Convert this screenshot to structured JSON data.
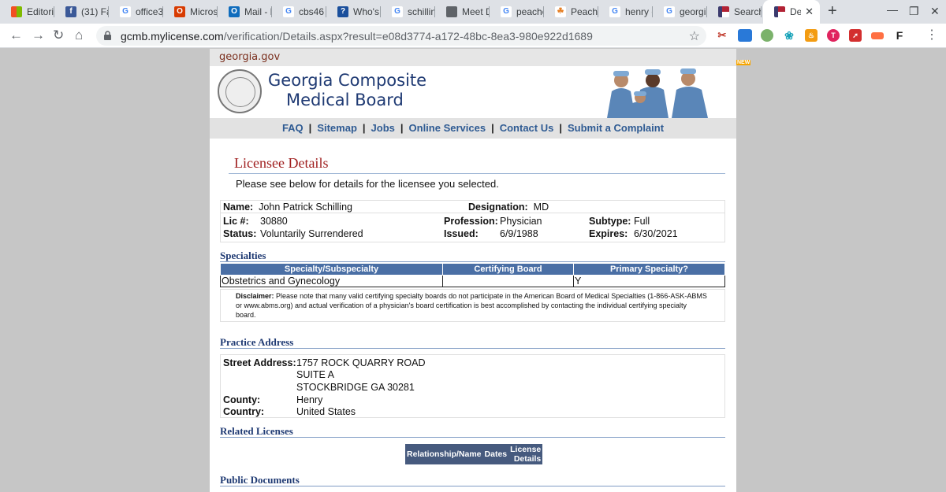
{
  "browser": {
    "tabs": [
      {
        "label": "Editoria",
        "fav": "windows"
      },
      {
        "label": "(31) Fa",
        "fav": "facebook"
      },
      {
        "label": "office3",
        "fav": "google"
      },
      {
        "label": "Micros",
        "fav": "office"
      },
      {
        "label": "Mail - R",
        "fav": "outlook"
      },
      {
        "label": "cbs46",
        "fav": "google"
      },
      {
        "label": "Who's",
        "fav": "generic"
      },
      {
        "label": "schillin",
        "fav": "google"
      },
      {
        "label": "Meet D",
        "fav": "globe"
      },
      {
        "label": "peachc",
        "fav": "google"
      },
      {
        "label": "Peachc",
        "fav": "peach"
      },
      {
        "label": "henry c",
        "fav": "google"
      },
      {
        "label": "georgia",
        "fav": "google"
      },
      {
        "label": "Search",
        "fav": "flag"
      },
      {
        "label": "Det",
        "fav": "flag",
        "active": true
      }
    ],
    "new_tab": "+",
    "close_tab": "✕",
    "url_host": "gcmb.mylicense.com",
    "url_path": "/verification/Details.aspx?result=e08d3774-a172-48bc-8ea3-980e922d1689",
    "ext_badge": "NEW"
  },
  "site": {
    "gagov": "georgia.gov",
    "board_line1": "Georgia Composite",
    "board_line2": "Medical Board",
    "menu": [
      "FAQ",
      "Sitemap",
      "Jobs",
      "Online Services",
      "Contact Us",
      "Submit a Complaint"
    ],
    "menu_sep": "|"
  },
  "details": {
    "title": "Licensee Details",
    "intro": "Please see below for details for the licensee you selected.",
    "name_label": "Name:",
    "name": "John Patrick Schilling",
    "designation_label": "Designation:",
    "designation": "MD",
    "lic_label": "Lic #:",
    "lic": "30880",
    "profession_label": "Profession:",
    "profession": "Physician",
    "subtype_label": "Subtype:",
    "subtype": "Full",
    "status_label": "Status:",
    "status": "Voluntarily Surrendered",
    "issued_label": "Issued:",
    "issued": "6/9/1988",
    "expires_label": "Expires:",
    "expires": "6/30/2021"
  },
  "specialties": {
    "heading": "Specialties",
    "headers": [
      "Specialty/Subspecialty",
      "Certifying Board",
      "Primary Specialty?"
    ],
    "rows": [
      [
        "Obstetrics and Gynecology",
        "",
        "Y"
      ]
    ],
    "disclaimer_label": "Disclaimer:",
    "disclaimer": "Please note that many valid certifying specialty boards do not participate in the American Board of Medical Specialties (1-866-ASK-ABMS or www.abms.org) and actual verification of a physician's board certification is best accomplished by contacting the individual certifying specialty board."
  },
  "practice": {
    "heading": "Practice Address",
    "street_label": "Street Address:",
    "street1": "1757 ROCK QUARRY ROAD",
    "street2": "SUITE A",
    "street3": "STOCKBRIDGE GA 30281",
    "county_label": "County:",
    "county": "Henry",
    "country_label": "Country:",
    "country": "United States"
  },
  "related": {
    "heading": "Related Licenses",
    "col1": "Relationship/Name",
    "col2": "Dates",
    "col3_l1": "License",
    "col3_l2": "Details"
  },
  "public_docs": {
    "heading": "Public Documents"
  }
}
